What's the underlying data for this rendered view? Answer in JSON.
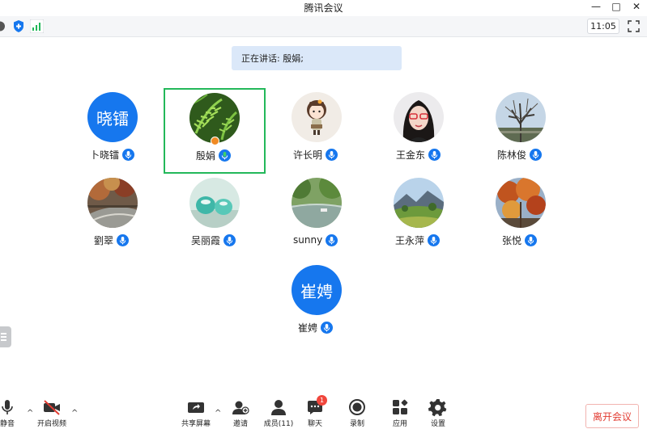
{
  "window": {
    "title": "腾讯会议",
    "minimize": "—",
    "maximize": "□",
    "close": "✕"
  },
  "status": {
    "time": "11:05"
  },
  "speaking": {
    "text": "正在讲话: 殷娟;"
  },
  "participants": [
    {
      "name": "卜晓镭",
      "avatar_text": "晓镭",
      "avatar_type": "text"
    },
    {
      "name": "殷娟",
      "avatar_type": "photo-fern",
      "active": true,
      "host": true
    },
    {
      "name": "许长明",
      "avatar_type": "photo-cartoon-girl"
    },
    {
      "name": "王金东",
      "avatar_type": "photo-woman-glasses"
    },
    {
      "name": "陈林俊",
      "avatar_type": "photo-tree"
    },
    {
      "name": "劉翠",
      "avatar_type": "photo-autumn-path"
    },
    {
      "name": "吴丽霞",
      "avatar_type": "photo-teal-cups"
    },
    {
      "name": "sunny",
      "avatar_type": "photo-pond"
    },
    {
      "name": "王永萍",
      "avatar_type": "photo-mountain"
    },
    {
      "name": "张悦",
      "avatar_type": "photo-maple"
    },
    {
      "name": "崔娉",
      "avatar_text": "崔娉",
      "avatar_type": "text"
    }
  ],
  "toolbar": {
    "mute": "静音",
    "video": "开启视频",
    "share": "共享屏幕",
    "invite": "邀请",
    "members": "成员(11)",
    "chat": "聊天",
    "chat_badge": "1",
    "record": "录制",
    "apps": "应用",
    "settings": "设置",
    "leave": "离开会议"
  },
  "colors": {
    "accent": "#1677ee",
    "active_border": "#23b85a",
    "leave": "#e23c32"
  }
}
